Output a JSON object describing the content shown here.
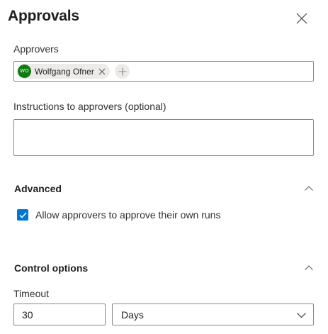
{
  "panel": {
    "title": "Approvals"
  },
  "approvers": {
    "label": "Approvers",
    "items": [
      {
        "name": "Wolfgang Ofner",
        "initials": "WO",
        "color": "#107c10"
      }
    ]
  },
  "instructions": {
    "label": "Instructions to approvers (optional)",
    "value": ""
  },
  "advanced": {
    "header": "Advanced",
    "expanded": true,
    "allow_self_approve": {
      "label": "Allow approvers to approve their own runs",
      "checked": true
    }
  },
  "control_options": {
    "header": "Control options",
    "expanded": true,
    "timeout": {
      "label": "Timeout",
      "value": "30",
      "unit": "Days"
    }
  },
  "colors": {
    "accent": "#0078d4",
    "border": "#8a8886",
    "chip_bg": "#edebe9"
  }
}
